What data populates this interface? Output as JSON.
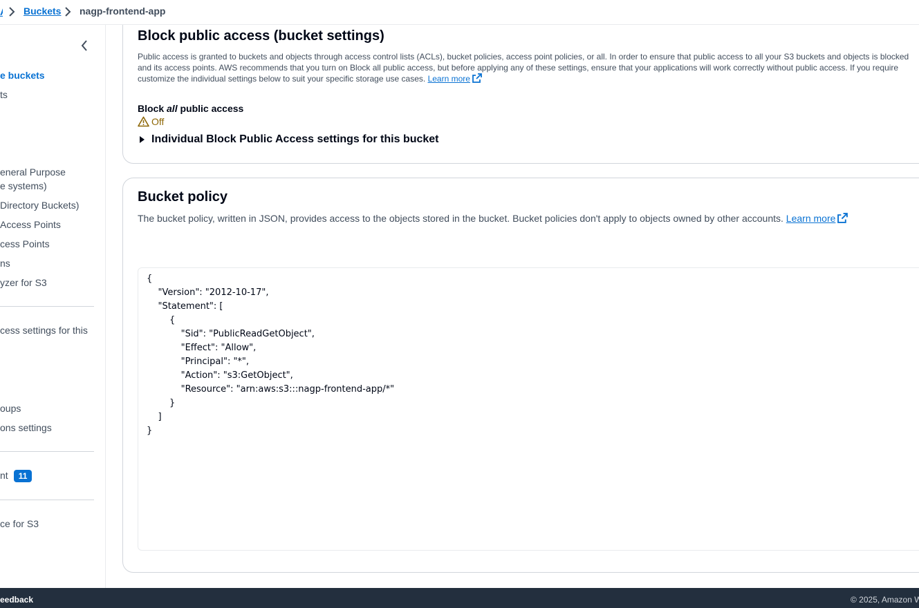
{
  "breadcrumb": {
    "items": [
      "Buckets",
      "nagp-frontend-app"
    ]
  },
  "sidebar": {
    "items": [
      {
        "label": "e buckets",
        "active": true
      },
      {
        "label": "ts"
      },
      {
        "label": "eneral Purpose"
      },
      {
        "label": "e systems)"
      },
      {
        "label": "Directory Buckets)"
      },
      {
        "label": "Access Points"
      },
      {
        "label": "cess Points"
      },
      {
        "label": "ns"
      },
      {
        "label": "yzer for S3"
      },
      {
        "label": "cess settings for this"
      },
      {
        "label": "oups"
      },
      {
        "label": "ons settings"
      },
      {
        "label": "nt"
      },
      {
        "label": "ce for S3"
      }
    ],
    "badge_count": "11"
  },
  "block_public_access": {
    "title": "Block public access (bucket settings)",
    "description_line1": "Public access is granted to buckets and objects through access control lists (ACLs), bucket policies, access point policies, or all. In order to ensure that public access to all your S3 buckets and objects is blocked",
    "description_line2": "and its access points. AWS recommends that you turn on Block all public access, but before applying any of these settings, ensure that your applications will work correctly without public access. If you require",
    "description_line3": "customize the individual settings below to suit your specific storage use cases.",
    "learn_more": "Learn more",
    "block_all_label_pre": "Block ",
    "block_all_label_em": "all",
    "block_all_label_post": " public access",
    "status": "Off",
    "expander_label": "Individual Block Public Access settings for this bucket"
  },
  "bucket_policy": {
    "title": "Bucket policy",
    "description": "The bucket policy, written in JSON, provides access to the objects stored in the bucket. Bucket policies don't apply to objects owned by other accounts.",
    "learn_more": "Learn more",
    "policy_json": "{\n    \"Version\": \"2012-10-17\",\n    \"Statement\": [\n        {\n            \"Sid\": \"PublicReadGetObject\",\n            \"Effect\": \"Allow\",\n            \"Principal\": \"*\",\n            \"Action\": \"s3:GetObject\",\n            \"Resource\": \"arn:aws:s3:::nagp-frontend-app/*\"\n        }\n    ]\n}"
  },
  "footer": {
    "feedback": "eedback",
    "copyright": "© 2025, Amazon W"
  },
  "colors": {
    "link": "#0972d3",
    "warning": "#8d6605",
    "footer_bg": "#232f3e"
  }
}
